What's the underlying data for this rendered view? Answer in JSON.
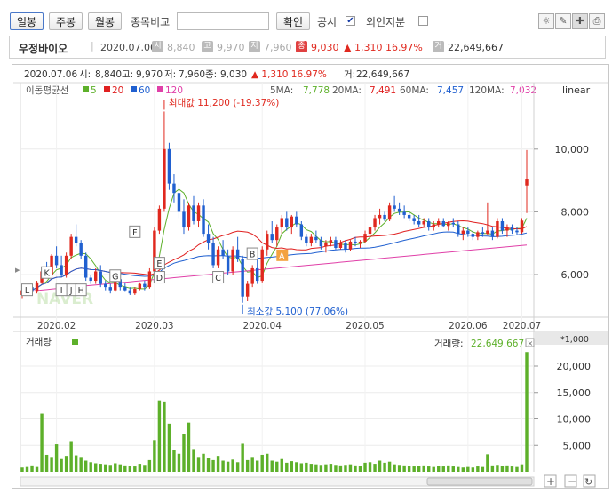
{
  "toolbar": {
    "tabs": [
      "일봉",
      "주봉",
      "월봉"
    ],
    "compare_label": "종목비교",
    "confirm_label": "확인",
    "disclosure_label": "공시",
    "disclosure_checked": "✔",
    "foreign_label": "외인지분",
    "icons": [
      "bulb-icon",
      "pencil-icon",
      "crosshair-icon",
      "print-icon"
    ]
  },
  "info": {
    "name": "우정바이오",
    "date": "2020.07.06",
    "open_badge": "시",
    "open": "8,840",
    "high_badge": "고",
    "high": "9,970",
    "low_badge": "저",
    "low": "7,960",
    "close_badge": "종",
    "close": "9,030",
    "change": "▲ 1,310 16.97%",
    "volume_badge": "거",
    "volume": "22,649,667"
  },
  "chart_data": {
    "type": "candlestick",
    "header": {
      "date": "2020.07.06",
      "open_label": "시:",
      "open": "8,840",
      "high_label": "고:",
      "high": "9,970",
      "low_label": "저:",
      "low": "7,960",
      "close_label": "종:",
      "close": "9,030",
      "change": "▲ 1,310 16.97%",
      "volume_label": "거:",
      "volume": "22,649,667"
    },
    "ma_legend": {
      "title": "이동평균선",
      "periods": [
        {
          "label": "5",
          "color": "#5db02a"
        },
        {
          "label": "20",
          "color": "#e02020"
        },
        {
          "label": "60",
          "color": "#2060d0"
        },
        {
          "label": "120",
          "color": "#e040a8"
        }
      ]
    },
    "ma_values": [
      {
        "label": "5MA:",
        "value": "7,778",
        "color": "#5db02a"
      },
      {
        "label": "20MA:",
        "value": "7,491",
        "color": "#e02020"
      },
      {
        "label": "60MA:",
        "value": "7,457",
        "color": "#2060d0"
      },
      {
        "label": "120MA:",
        "value": "7,032",
        "color": "#e040a8"
      }
    ],
    "scale_label": "linear",
    "price_ticks": [
      "10,000",
      "8,000",
      "6,000"
    ],
    "price_tick_values": [
      10000,
      8000,
      6000
    ],
    "x_labels": [
      "2020.02",
      "2020.03",
      "2020.04",
      "2020.05",
      "2020.06",
      "2020.07"
    ],
    "max_annotation": "최대값 11,200 (-19.37%)",
    "min_annotation": "최소값 5,100 (77.06%)",
    "max_value": 11200,
    "min_value": 5100,
    "pattern_labels": [
      "L",
      "K",
      "J",
      "I",
      "H",
      "G",
      "F",
      "E",
      "D",
      "C",
      "B",
      "A"
    ],
    "watermark": "NAVER",
    "volume": {
      "title": "거래량",
      "last_label": "거래량:",
      "last_value": "22,649,667",
      "unit_label": "*1,000",
      "ticks": [
        "20,000",
        "15,000",
        "10,000",
        "5,000"
      ],
      "tick_values": [
        20000,
        15000,
        10000,
        5000
      ],
      "ymax": 24000
    },
    "candles": [
      [
        5350,
        5600,
        5250,
        5500
      ],
      [
        5500,
        5700,
        5400,
        5600
      ],
      [
        5600,
        5700,
        5350,
        5450
      ],
      [
        5450,
        5800,
        5400,
        5750
      ],
      [
        5750,
        6200,
        5700,
        6100
      ],
      [
        6100,
        6400,
        5900,
        6000
      ],
      [
        6000,
        6650,
        5950,
        6600
      ],
      [
        6600,
        6900,
        6200,
        6300
      ],
      [
        6300,
        6600,
        5900,
        6000
      ],
      [
        6000,
        6700,
        5900,
        6600
      ],
      [
        6600,
        7300,
        6500,
        7200
      ],
      [
        7200,
        7600,
        6900,
        7000
      ],
      [
        7000,
        7100,
        6500,
        6600
      ],
      [
        6600,
        6700,
        5800,
        5900
      ],
      [
        5900,
        6000,
        5700,
        5800
      ],
      [
        5800,
        6200,
        5700,
        6100
      ],
      [
        6100,
        6300,
        5600,
        5700
      ],
      [
        5700,
        5800,
        5500,
        5600
      ],
      [
        5600,
        5700,
        5400,
        5500
      ],
      [
        5500,
        5900,
        5450,
        5850
      ],
      [
        5850,
        5900,
        5500,
        5600
      ],
      [
        5600,
        5750,
        5450,
        5500
      ],
      [
        5500,
        5600,
        5350,
        5400
      ],
      [
        5400,
        5600,
        5350,
        5550
      ],
      [
        5550,
        5750,
        5500,
        5700
      ],
      [
        5700,
        5800,
        5500,
        5600
      ],
      [
        5600,
        6200,
        5550,
        6100
      ],
      [
        6100,
        7500,
        6050,
        7400
      ],
      [
        7400,
        8200,
        7300,
        8100
      ],
      [
        8100,
        11200,
        8000,
        10000
      ],
      [
        10000,
        10200,
        8700,
        8900
      ],
      [
        8900,
        9200,
        8300,
        8600
      ],
      [
        8600,
        8900,
        7800,
        8000
      ],
      [
        8000,
        8400,
        7300,
        7500
      ],
      [
        7500,
        8300,
        7400,
        8200
      ],
      [
        8200,
        8500,
        7600,
        7700
      ],
      [
        7700,
        8300,
        7500,
        8200
      ],
      [
        8200,
        8400,
        7200,
        7300
      ],
      [
        7300,
        7600,
        6800,
        7000
      ],
      [
        7000,
        7200,
        6200,
        6300
      ],
      [
        6300,
        6900,
        6200,
        6800
      ],
      [
        6800,
        7100,
        6500,
        6600
      ],
      [
        6600,
        6800,
        6000,
        6100
      ],
      [
        6100,
        6900,
        6000,
        6800
      ],
      [
        6800,
        7200,
        6400,
        6500
      ],
      [
        6500,
        6600,
        5100,
        5300
      ],
      [
        5300,
        5800,
        5150,
        5700
      ],
      [
        5700,
        6300,
        5600,
        6200
      ],
      [
        6200,
        6500,
        5700,
        5800
      ],
      [
        5800,
        6900,
        5750,
        6800
      ],
      [
        6800,
        7400,
        6600,
        7300
      ],
      [
        7300,
        7700,
        7000,
        7100
      ],
      [
        7100,
        7600,
        6900,
        7500
      ],
      [
        7500,
        7900,
        7300,
        7800
      ],
      [
        7800,
        8000,
        7400,
        7500
      ],
      [
        7500,
        7900,
        7300,
        7850
      ],
      [
        7850,
        8000,
        7500,
        7600
      ],
      [
        7600,
        7700,
        7100,
        7200
      ],
      [
        7200,
        7300,
        6900,
        7000
      ],
      [
        7000,
        7300,
        6900,
        7200
      ],
      [
        7200,
        7400,
        7000,
        7100
      ],
      [
        7100,
        7200,
        6800,
        6900
      ],
      [
        6900,
        7100,
        6700,
        7000
      ],
      [
        7000,
        7200,
        6900,
        7100
      ],
      [
        7100,
        7200,
        6800,
        6850
      ],
      [
        6850,
        7100,
        6800,
        7000
      ],
      [
        7000,
        7100,
        6700,
        6800
      ],
      [
        6800,
        7100,
        6750,
        7050
      ],
      [
        7050,
        7200,
        6900,
        7000
      ],
      [
        7000,
        7100,
        6850,
        7050
      ],
      [
        7050,
        7400,
        7000,
        7300
      ],
      [
        7300,
        7600,
        7200,
        7500
      ],
      [
        7500,
        7900,
        7400,
        7800
      ],
      [
        7800,
        8100,
        7600,
        7900
      ],
      [
        7900,
        8000,
        7700,
        7750
      ],
      [
        7750,
        8300,
        7700,
        8200
      ],
      [
        8200,
        8500,
        8000,
        8100
      ],
      [
        8100,
        8300,
        7900,
        8000
      ],
      [
        8000,
        8200,
        7800,
        7900
      ],
      [
        7900,
        8000,
        7700,
        7800
      ],
      [
        7800,
        7900,
        7600,
        7700
      ],
      [
        7700,
        7900,
        7500,
        7600
      ],
      [
        7600,
        7800,
        7500,
        7700
      ],
      [
        7700,
        7800,
        7400,
        7500
      ],
      [
        7500,
        7700,
        7400,
        7600
      ],
      [
        7600,
        7800,
        7500,
        7700
      ],
      [
        7700,
        7800,
        7500,
        7550
      ],
      [
        7550,
        7700,
        7400,
        7650
      ],
      [
        7650,
        7800,
        7500,
        7600
      ],
      [
        7600,
        7700,
        7200,
        7300
      ],
      [
        7300,
        7500,
        7100,
        7400
      ],
      [
        7400,
        7500,
        7200,
        7300
      ],
      [
        7300,
        7400,
        7100,
        7200
      ],
      [
        7200,
        7400,
        7100,
        7350
      ],
      [
        7350,
        7500,
        7200,
        7300
      ],
      [
        7300,
        8300,
        7250,
        7400
      ],
      [
        7400,
        7500,
        7100,
        7200
      ],
      [
        7200,
        7800,
        7150,
        7700
      ],
      [
        7700,
        7800,
        7300,
        7400
      ],
      [
        7400,
        7600,
        7200,
        7500
      ],
      [
        7500,
        7600,
        7300,
        7400
      ],
      [
        7400,
        7500,
        7250,
        7350
      ],
      [
        7350,
        7800,
        7300,
        7720
      ],
      [
        8840,
        9970,
        7960,
        9030
      ]
    ],
    "volumes": [
      800,
      900,
      1200,
      900,
      11000,
      3200,
      2800,
      5200,
      2400,
      3000,
      5800,
      3100,
      2800,
      2100,
      1800,
      1600,
      1500,
      1400,
      1300,
      1600,
      1400,
      1200,
      1100,
      1000,
      1500,
      1300,
      2200,
      6000,
      13500,
      13300,
      9100,
      4200,
      3400,
      7100,
      9300,
      4300,
      2800,
      3400,
      2600,
      2200,
      3000,
      2100,
      1900,
      2300,
      1800,
      5300,
      2200,
      2800,
      2100,
      3200,
      3400,
      2100,
      1900,
      2400,
      1700,
      2000,
      1800,
      1600,
      1700,
      1500,
      1400,
      1300,
      1400,
      1500,
      1300,
      1200,
      1300,
      1400,
      1200,
      1100,
      1700,
      1800,
      1500,
      2100,
      1700,
      1900,
      1400,
      1300,
      1200,
      1100,
      1000,
      1100,
      1200,
      1000,
      900,
      1100,
      1000,
      1200,
      1000,
      900,
      800,
      900,
      800,
      1000,
      900,
      3300,
      1200,
      1300,
      1100,
      1200,
      1000,
      900,
      1400,
      22650
    ]
  }
}
